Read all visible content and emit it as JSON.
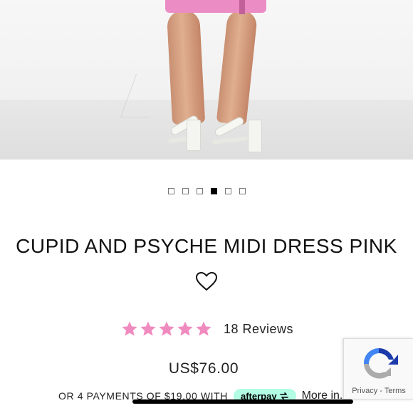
{
  "product": {
    "title": "CUPID AND PSYCHE MIDI DRESS PINK",
    "price": "US$76.00",
    "image_alt_icon": "product-photo",
    "accent_color": "#f08bc0"
  },
  "carousel": {
    "total": 6,
    "active_index": 3
  },
  "rating": {
    "stars": 5,
    "max_stars": 5,
    "reviews_label": "18 Reviews",
    "star_color": "#f08bc0"
  },
  "installments": {
    "text": "OR 4 PAYMENTS OF $19.00 WITH",
    "provider_label": "afterpay",
    "provider_color": "#b2fce4",
    "more_info_label": "More in..."
  },
  "recaptcha": {
    "links_label": "Privacy - Terms"
  }
}
